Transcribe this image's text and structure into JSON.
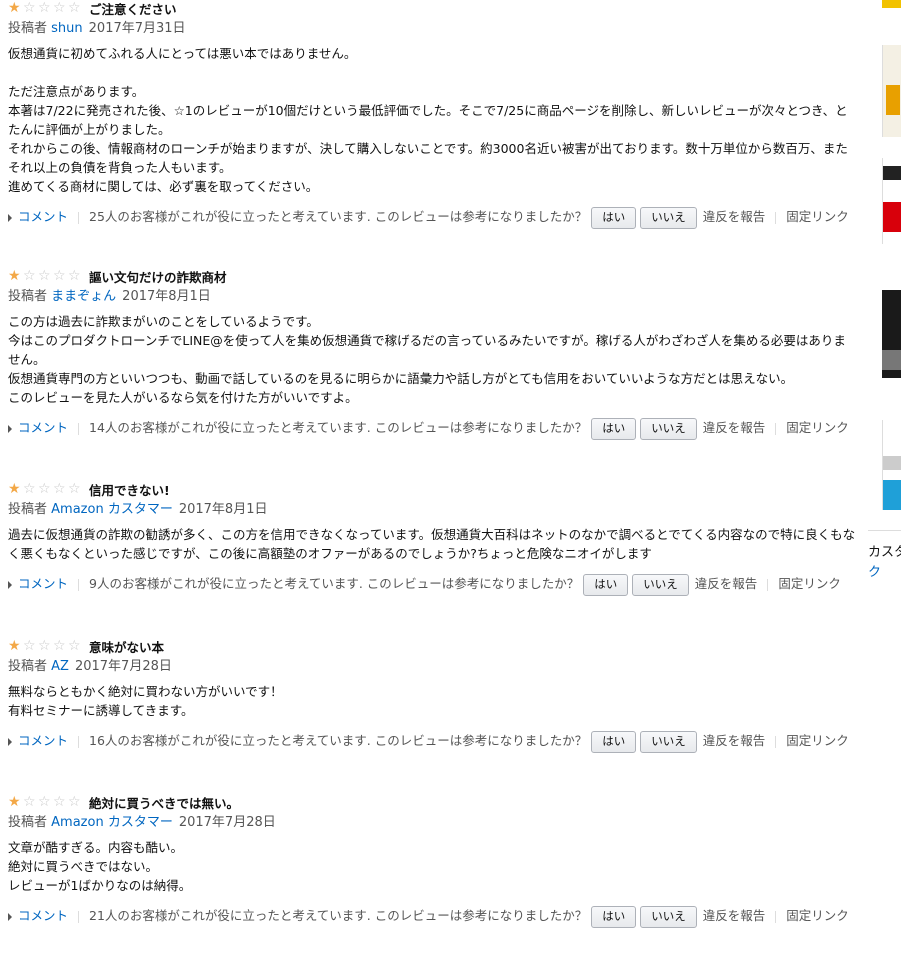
{
  "reviews": [
    {
      "rating": 1,
      "title": "ご注意ください",
      "byline_prefix": "投稿者",
      "author": "shun",
      "date": "2017年7月31日",
      "body": "仮想通貨に初めてふれる人にとっては悪い本ではありません。\n\nただ注意点があります。\n本著は7/22に発売された後、☆1のレビューが10個だけという最低評価でした。そこで7/25に商品ページを削除し、新しいレビューが次々とつき、とたんに評価が上がりました。\nそれからこの後、情報商材のローンチが始まりますが、決して購入しないことです。約3000名近い被害が出ております。数十万単位から数百万、またそれ以上の負債を背負った人もいます。\n進めてくる商材に関しては、必ず裏を取ってください。",
      "helpful": "25人のお客様がこれが役に立ったと考えています. このレビューは参考になりましたか？"
    },
    {
      "rating": 1,
      "title": "謳い文句だけの詐欺商材",
      "byline_prefix": "投稿者",
      "author": "ままぞょん",
      "date": "2017年8月1日",
      "body": "この方は過去に詐欺まがいのことをしているようです。\n今はこのプロダクトローンチでLINE@を使って人を集め仮想通貨で稼げるだの言っているみたいですが。稼げる人がわざわざ人を集める必要はありません。\n仮想通貨専門の方といいつつも、動画で話しているのを見るに明らかに語彙力や話し方がとても信用をおいていいような方だとは思えない。\nこのレビューを見た人がいるなら気を付けた方がいいですよ。",
      "helpful": "14人のお客様がこれが役に立ったと考えています. このレビューは参考になりましたか？"
    },
    {
      "rating": 1,
      "title": "信用できない!",
      "byline_prefix": "投稿者",
      "author": "Amazon カスタマー",
      "date": "2017年8月1日",
      "body": "過去に仮想通貨の詐欺の勧誘が多く、この方を信用できなくなっています。仮想通貨大百科はネットのなかで調べるとでてくる内容なので特に良くもなく悪くもなくといった感じですが、この後に高額塾のオファーがあるのでしょうか?ちょっと危険なニオイがします",
      "helpful": "9人のお客様がこれが役に立ったと考えています. このレビューは参考になりましたか？"
    },
    {
      "rating": 1,
      "title": "意味がない本",
      "byline_prefix": "投稿者",
      "author": "AZ",
      "date": "2017年7月28日",
      "body": "無料ならともかく絶対に買わない方がいいです！\n有料セミナーに誘導してきます。",
      "helpful": "16人のお客様がこれが役に立ったと考えています. このレビューは参考になりましたか？"
    },
    {
      "rating": 1,
      "title": "絶対に買うべきでは無い。",
      "byline_prefix": "投稿者",
      "author": "Amazon カスタマー",
      "date": "2017年7月28日",
      "body": "文章が酷すぎる。内容も酷い。\n絶対に買うべきではない。\nレビューが1ばかりなのは納得。",
      "helpful": "21人のお客様がこれが役に立ったと考えています. このレビューは参考になりましたか？"
    }
  ],
  "actions": {
    "comment": "コメント",
    "yes": "はい",
    "no": "いいえ",
    "report": "違反を報告",
    "permalink": "固定リンク"
  },
  "rail": {
    "text_line1": "カスタ",
    "text_line2": "ク"
  },
  "colors": {
    "link": "#0066c0",
    "star": "#f3a847"
  }
}
